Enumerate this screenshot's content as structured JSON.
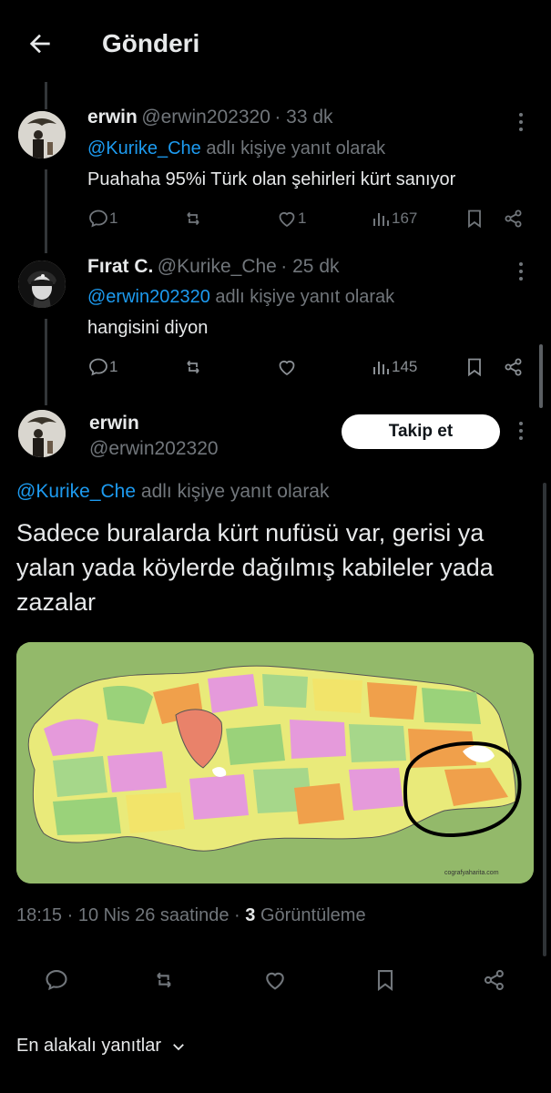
{
  "header": {
    "title": "Gönderi",
    "back_icon": "arrow-left-icon"
  },
  "replies": [
    {
      "name": "erwin",
      "handle": "@erwin202320",
      "time": "· 33 dk",
      "reply_prefix": "@Kurike_Che",
      "reply_suffix": "adlı kişiye yanıt olarak",
      "text": "Puahaha 95%i Türk olan şehirleri kürt sanıyor",
      "replies_count": "1",
      "likes_count": "1",
      "views_count": "167"
    },
    {
      "name": "Fırat C.",
      "handle": "@Kurike_Che",
      "time": "· 25 dk",
      "reply_prefix": "@erwin202320",
      "reply_suffix": "adlı kişiye yanıt olarak",
      "text": "hangisini diyon",
      "replies_count": "1",
      "likes_count": "",
      "views_count": "145"
    }
  ],
  "main_post": {
    "name": "erwin",
    "handle": "@erwin202320",
    "follow_label": "Takip et",
    "reply_prefix": "@Kurike_Che",
    "reply_suffix": "adlı kişiye yanıt olarak",
    "text": "Sadece buralarda kürt nufüsü var, gerisi ya yalan yada köylerde dağılmış kabileler yada zazalar",
    "time": "18:15 · 10 Nis 26 saatinde ·",
    "views": "3",
    "views_label": "Görüntüleme",
    "map_caption": "cografyaharita.com"
  },
  "sort": {
    "label": "En alakalı yanıtlar"
  },
  "colors": {
    "accent": "#1d9bf0",
    "background": "#000000",
    "muted": "#71767b"
  }
}
